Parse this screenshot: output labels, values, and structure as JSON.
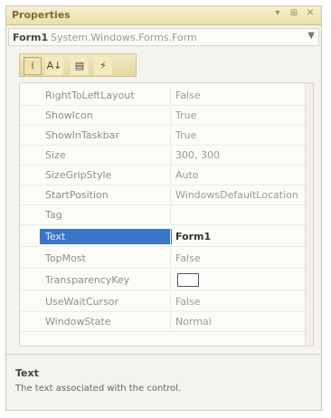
{
  "window": {
    "title": "Properties"
  },
  "selector": {
    "object": "Form1",
    "type": "System.Windows.Forms.Form"
  },
  "toolbar": {
    "categorized": "⁞",
    "alphabetical": "A↓",
    "properties": "▤",
    "events": "⚡"
  },
  "properties": [
    {
      "name": "RightToLeftLayout",
      "value": "False"
    },
    {
      "name": "ShowIcon",
      "value": "True"
    },
    {
      "name": "ShowInTaskbar",
      "value": "True"
    },
    {
      "name": "Size",
      "value": "300, 300"
    },
    {
      "name": "SizeGripStyle",
      "value": "Auto"
    },
    {
      "name": "StartPosition",
      "value": "WindowsDefaultLocation"
    },
    {
      "name": "Tag",
      "value": ""
    },
    {
      "name": "Text",
      "value": "Form1",
      "selected": true
    },
    {
      "name": "TopMost",
      "value": "False"
    },
    {
      "name": "TransparencyKey",
      "value": ""
    },
    {
      "name": "UseWaitCursor",
      "value": "False"
    },
    {
      "name": "WindowState",
      "value": "Normal"
    }
  ],
  "description": {
    "title": "Text",
    "text": "The text associated with the control."
  }
}
